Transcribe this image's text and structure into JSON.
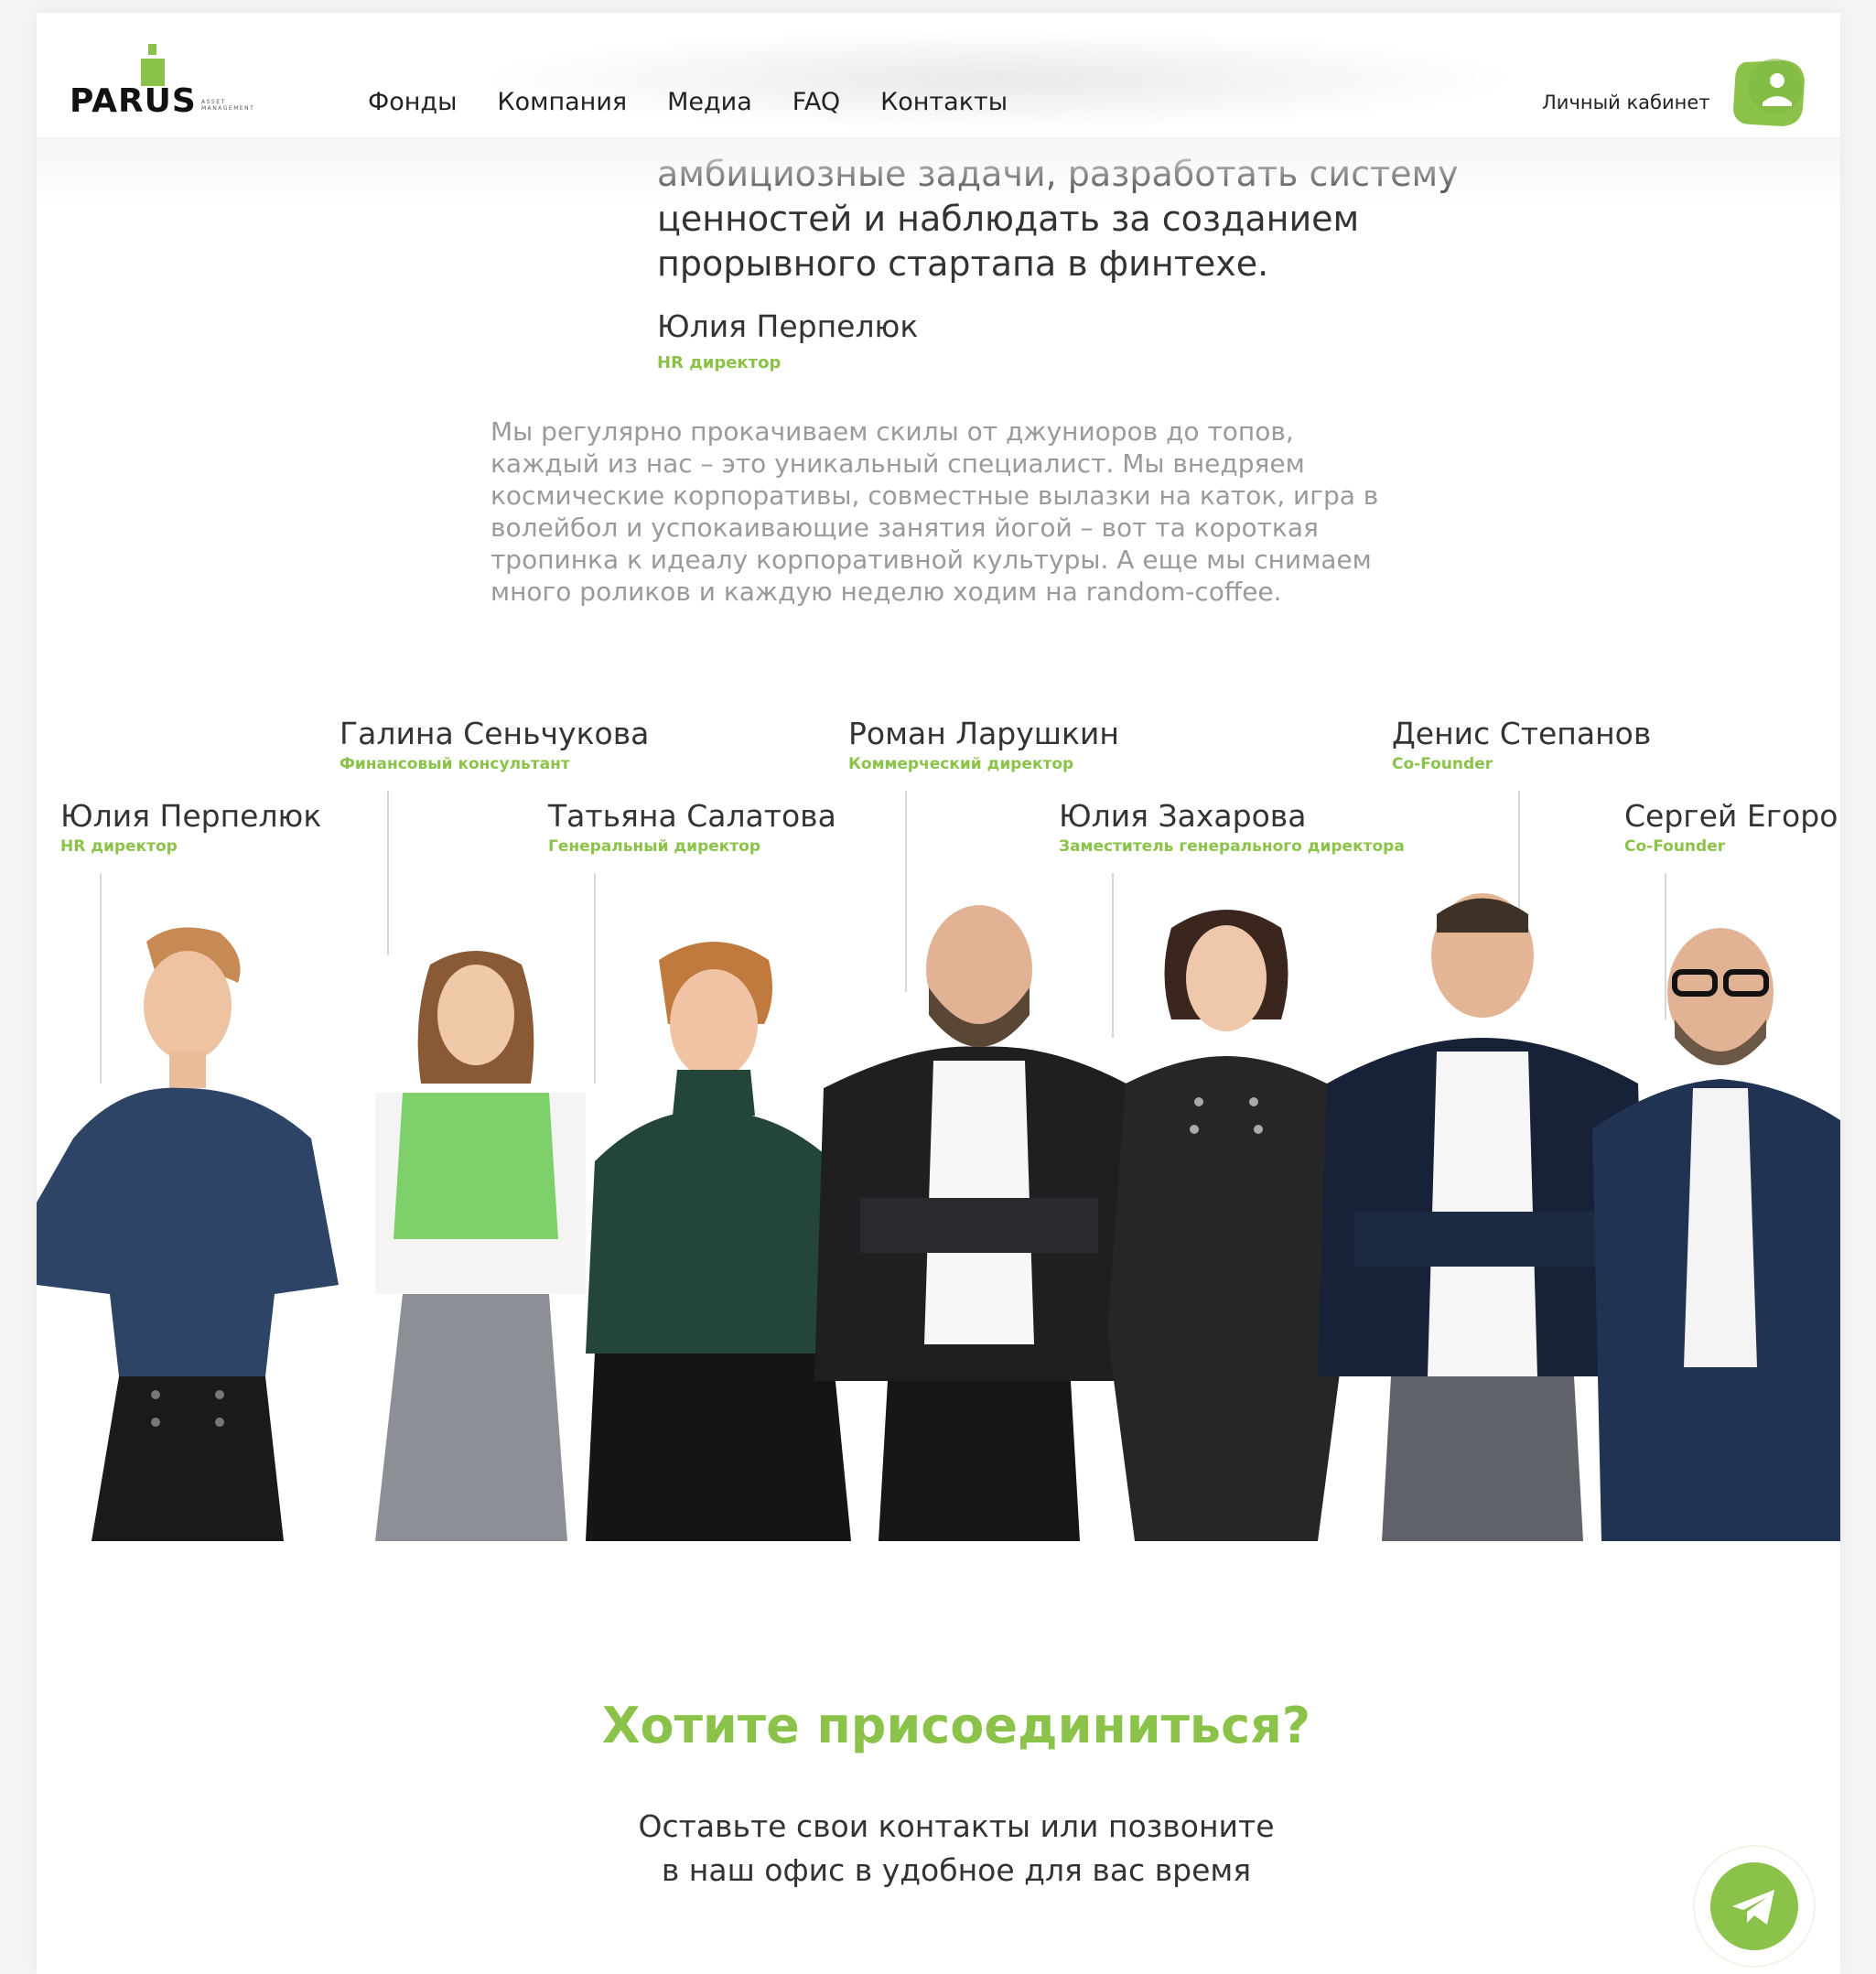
{
  "brand": {
    "logo_text": "PARUS",
    "logo_sub": "ASSET MANAGEMENT",
    "accent": "#8bc34a"
  },
  "nav": {
    "items": [
      {
        "label": "Фонды"
      },
      {
        "label": "Компания"
      },
      {
        "label": "Медиа"
      },
      {
        "label": "FAQ"
      },
      {
        "label": "Контакты"
      }
    ]
  },
  "account": {
    "label": "Личный кабинет",
    "icon": "user-icon"
  },
  "quote": {
    "lines": [
      "амбициозные задачи, разработать систему",
      "ценностей и наблюдать за созданием",
      "прорывного стартапа в финтехе."
    ],
    "author": "Юлия Перпелюк",
    "role": "HR директор"
  },
  "culture": {
    "lines": [
      "Мы регулярно прокачиваем скилы от джуниоров до топов,",
      "каждый из нас – это уникальный специалист. Мы внедряем",
      "космические корпоративы, совместные вылазки на каток, игра в",
      "волейбол и успокаивающие занятия йогой – вот та короткая",
      "тропинка к идеалу корпоративной культуры. А еще мы снимаем",
      "много роликов и каждую неделю ходим на random-coffee."
    ]
  },
  "team": {
    "members": [
      {
        "name": "Юлия Перпелюк",
        "role": "HR директор"
      },
      {
        "name": "Галина Сеньчукова",
        "role": "Финансовый консультант"
      },
      {
        "name": "Татьяна Салатова",
        "role": "Генеральный директор"
      },
      {
        "name": "Роман Ларушкин",
        "role": "Коммерческий директор"
      },
      {
        "name": "Юлия Захарова",
        "role": "Заместитель генерального директора"
      },
      {
        "name": "Денис Степанов",
        "role": "Co-Founder"
      },
      {
        "name": "Сергей Егоров",
        "role": "Co-Founder"
      }
    ]
  },
  "join": {
    "title": "Хотите присоединиться?",
    "lines": [
      "Оставьте свои контакты или позвоните",
      "в наш офис в удобное для вас время"
    ]
  },
  "telegram": {
    "icon": "telegram-icon"
  }
}
